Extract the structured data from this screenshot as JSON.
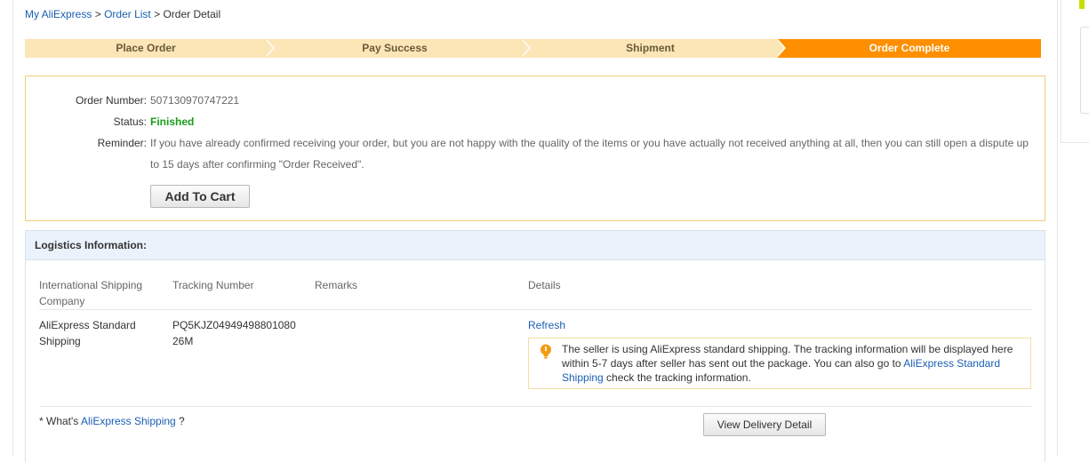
{
  "breadcrumb": {
    "home": "My AliExpress",
    "sep1": ">",
    "list": "Order List",
    "sep2": ">",
    "current": "Order Detail"
  },
  "steps": [
    {
      "label": "Place Order",
      "active": false
    },
    {
      "label": "Pay Success",
      "active": false
    },
    {
      "label": "Shipment",
      "active": false
    },
    {
      "label": "Order Complete",
      "active": true
    }
  ],
  "order": {
    "number_label": "Order Number:",
    "number": "507130970747221",
    "status_label": "Status:",
    "status": "Finished",
    "reminder_label": "Reminder:",
    "reminder": "If you have already confirmed receiving your order, but you are not happy with the quality of the items or you have actually not received anything at all, then you can still open a dispute up to 15 days after confirming \"Order Received\".",
    "add_to_cart": "Add To Cart"
  },
  "logistics": {
    "title": "Logistics Information:",
    "headers": {
      "company": "International Shipping Company",
      "tracking": "Tracking Number",
      "remarks": "Remarks",
      "details": "Details"
    },
    "row": {
      "company": "AliExpress Standard Shipping",
      "tracking_line1": "PQ5KJZ04949498801080",
      "tracking_line2": "26M",
      "remarks": "",
      "refresh": "Refresh"
    },
    "notice": {
      "text_before": "The seller is using AliExpress standard shipping. The tracking information will be displayed here within 5-7 days after seller has sent out the package. You can also go to ",
      "link": "AliExpress Standard Shipping",
      "text_after": " check the tracking information."
    },
    "footer": {
      "prefix": "* What's ",
      "link": "AliExpress Shipping",
      "suffix": " ?"
    },
    "view_delivery": "View Delivery Detail"
  },
  "colors": {
    "step_inactive": "#fce5b6",
    "step_active": "#fe8f00",
    "status_finished": "#1a9e1a",
    "link": "#1a5fb4"
  }
}
